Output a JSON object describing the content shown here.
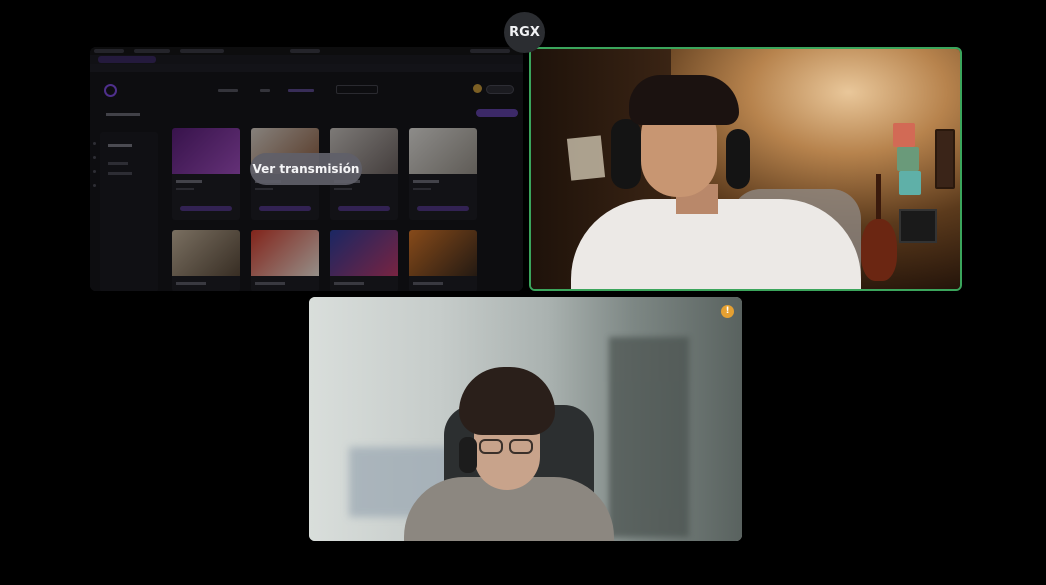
{
  "call": {
    "avatar_initials": "RGX",
    "screen_share": {
      "overlay_button_label": "Ver transmisión"
    },
    "speaking_indicator_color": "#3ba55c",
    "warning_badge": {
      "icon": "warning-icon",
      "glyph": "!",
      "color": "#e5a032"
    }
  }
}
